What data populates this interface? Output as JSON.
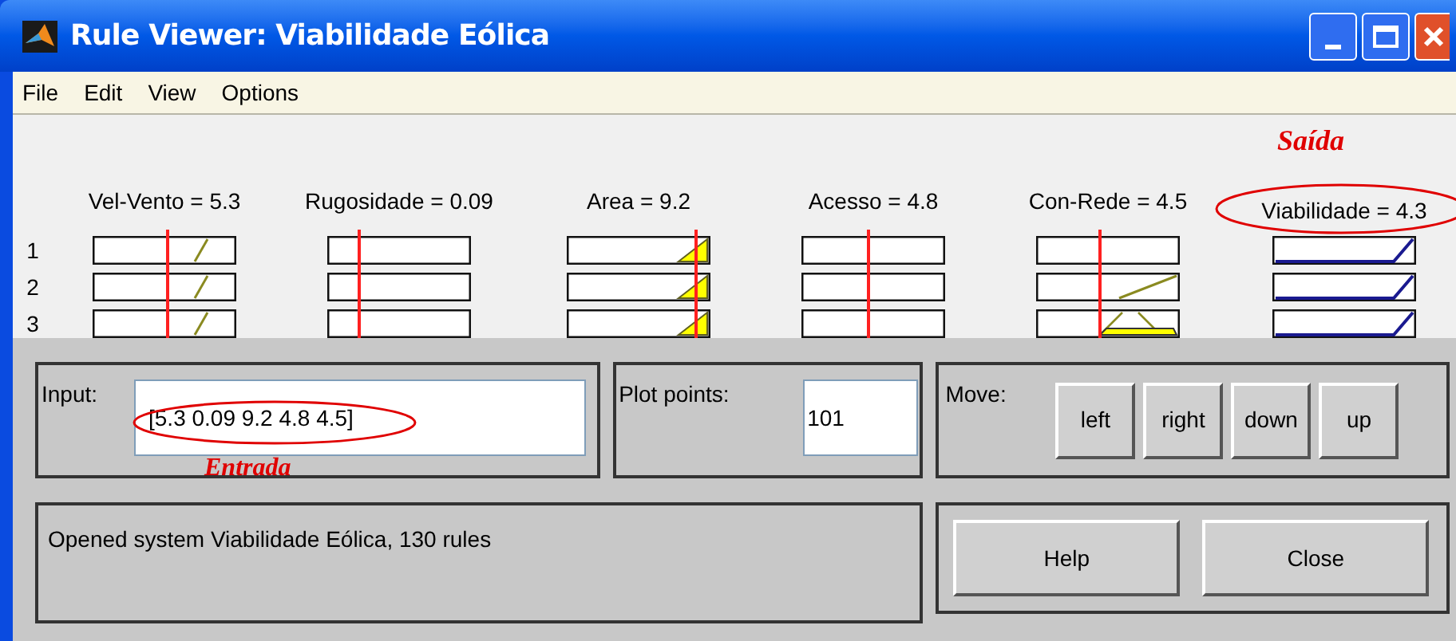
{
  "window": {
    "title": "Rule Viewer: Viabilidade Eólica"
  },
  "menu": [
    "File",
    "Edit",
    "View",
    "Options"
  ],
  "row_numbers": [
    "1",
    "2",
    "3"
  ],
  "variables": [
    {
      "label": "Vel-Vento = 5.3",
      "kind": "input",
      "level": 0.52,
      "rows": [
        {
          "kind": "slope"
        },
        {
          "kind": "slope"
        },
        {
          "kind": "slope"
        }
      ]
    },
    {
      "label": "Rugosidade = 0.09",
      "kind": "input",
      "level": 0.22,
      "rows": [
        {
          "kind": "empty"
        },
        {
          "kind": "empty"
        },
        {
          "kind": "empty"
        }
      ]
    },
    {
      "label": "Area = 9.2",
      "kind": "input",
      "level": 0.9,
      "rows": [
        {
          "kind": "filled-ramp"
        },
        {
          "kind": "filled-ramp"
        },
        {
          "kind": "filled-ramp"
        }
      ]
    },
    {
      "label": "Acesso = 4.8",
      "kind": "input",
      "level": 0.47,
      "rows": [
        {
          "kind": "empty"
        },
        {
          "kind": "empty"
        },
        {
          "kind": "empty"
        }
      ]
    },
    {
      "label": "Con-Rede = 4.5",
      "kind": "input",
      "level": 0.44,
      "rows": [
        {
          "kind": "empty"
        },
        {
          "kind": "rising-line"
        },
        {
          "kind": "filled-trapezoid"
        }
      ]
    },
    {
      "label": "Viabilidade = 4.3",
      "kind": "output",
      "rows": [
        {
          "kind": "output-ramp"
        },
        {
          "kind": "output-ramp"
        },
        {
          "kind": "output-ramp"
        }
      ]
    }
  ],
  "annotations": {
    "output": "Saída",
    "input": "Entrada"
  },
  "input": {
    "label": "Input:",
    "value": "[5.3 0.09 9.2 4.8 4.5]"
  },
  "plot_points": {
    "label": "Plot points:",
    "value": "101"
  },
  "move": {
    "label": "Move:",
    "buttons": [
      "left",
      "right",
      "down",
      "up"
    ]
  },
  "status": "Opened system Viabilidade Eólica, 130 rules",
  "buttons": [
    "Help",
    "Close"
  ]
}
